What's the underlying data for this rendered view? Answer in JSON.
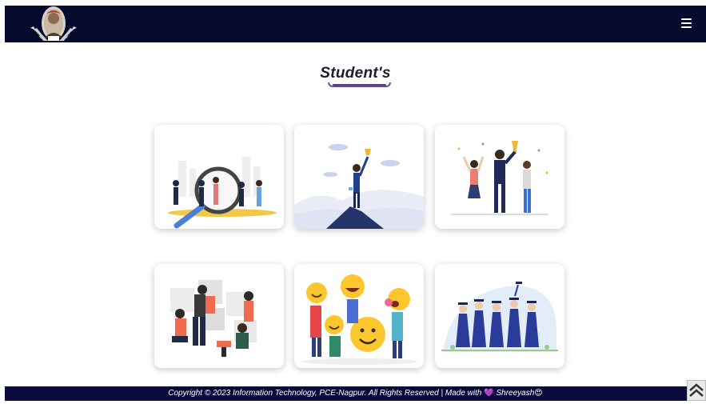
{
  "nav": {
    "logo_icon": "college-emblem-icon",
    "menu_icon": "hamburger-menu-icon"
  },
  "page": {
    "title": "Student's"
  },
  "cards": [
    {
      "illustration": "recruitment-magnifier-illustration"
    },
    {
      "illustration": "mountain-top-achievement-illustration"
    },
    {
      "illustration": "team-celebration-illustration"
    },
    {
      "illustration": "teamwork-puzzle-illustration"
    },
    {
      "illustration": "emoji-faces-illustration"
    },
    {
      "illustration": "graduation-group-illustration"
    }
  ],
  "footer": {
    "text_before": "Copyright © 2023 Information Technology, PCE-Nagpur. All Rights Reserved | Made with",
    "heart": "💜",
    "author": "Shreeyash",
    "author_emoji": "😍"
  },
  "scroll_top_icon": "double-chevron-up-icon",
  "colors": {
    "navbar": "#060b2e",
    "footer": "#0a0a3d",
    "accent": "#5b3f93"
  }
}
